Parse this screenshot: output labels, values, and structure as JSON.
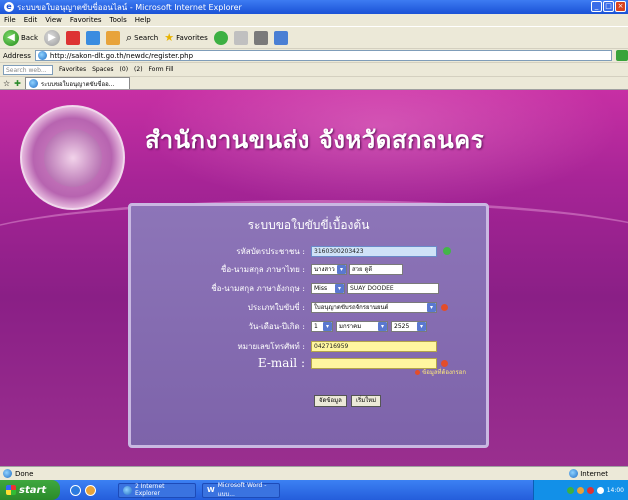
{
  "window": {
    "title": "ระบบขอใบอนุญาตขับขี่ออนไลน์ - Microsoft Internet Explorer",
    "min_label": "_",
    "max_label": "□",
    "close_label": "×"
  },
  "menu": [
    "File",
    "Edit",
    "View",
    "Favorites",
    "Tools",
    "Help"
  ],
  "toolbar": {
    "back_label": "Back",
    "search_label": "Search",
    "favorites_label": "Favorites"
  },
  "address": {
    "label": "Address",
    "url": "http://sakon-dlt.go.th/newdc/register.php"
  },
  "links": {
    "search_placeholder": "Search web...",
    "items": [
      "Favorites",
      "Spaces",
      "(0)",
      "(2)",
      "Form Fill"
    ]
  },
  "tab": {
    "label": "ระบบขอใบอนุญาตขับขี่ออ..."
  },
  "page": {
    "header_title": "สำนักงานขนส่ง  จังหวัดสกลนคร"
  },
  "form": {
    "title": "ระบบขอใบขับขี่เบื้องต้น",
    "id_label": "รหัสบัตรประชาชน :",
    "id_value": "3160300203423",
    "thai_name_label": "ชื่อ-นามสกุล ภาษาไทย :",
    "thai_prefix": "นางสาว",
    "thai_name_value": "สวย ดูดี",
    "eng_name_label": "ชื่อ-นามสกุล ภาษาอังกฤษ :",
    "eng_prefix": "Miss",
    "eng_name_value": "SUAY DOODEE",
    "license_type_label": "ประเภทใบขับขี่ :",
    "license_type_value": "ใบอนุญาตขับรถจักรยานยนต์",
    "birth_label": "วัน-เดือน-ปีเกิด :",
    "birth_day": "1",
    "birth_month": "มกราคม",
    "birth_year": "2525",
    "phone_label": "หมายเลขโทรศัพท์ :",
    "phone_value": "042716959",
    "email_label": "E-mail :",
    "email_value": "",
    "required_note": "ข้อมูลที่ต้องกรอก",
    "submit_label": "จัดข้อมูล",
    "reset_label": "เริ่มใหม่"
  },
  "status": {
    "left": "Done",
    "zone": "Internet"
  },
  "taskbar": {
    "start_label": "start",
    "tasks": [
      "2 Internet Explorer",
      "Microsoft Word - แบบ..."
    ],
    "clock": "14:00"
  }
}
